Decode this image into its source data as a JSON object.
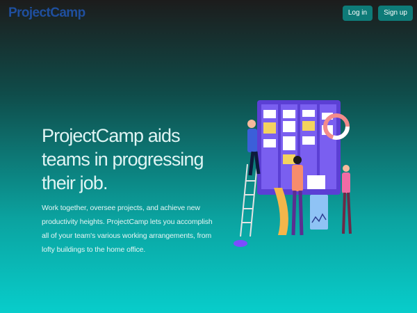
{
  "nav": {
    "logo": "ProjectCamp",
    "login_label": "Log in",
    "signup_label": "Sign up"
  },
  "hero": {
    "title": "ProjectCamp aids teams in progressing their job.",
    "description": "Work together, oversee projects, and achieve new productivity heights. ProjectCamp lets you accomplish all of your team's various working arrangements, from lofty buildings to the home office."
  },
  "colors": {
    "accent": "#0e7b78",
    "logo": "#1f4f9e",
    "board": "#5b3fd4"
  }
}
